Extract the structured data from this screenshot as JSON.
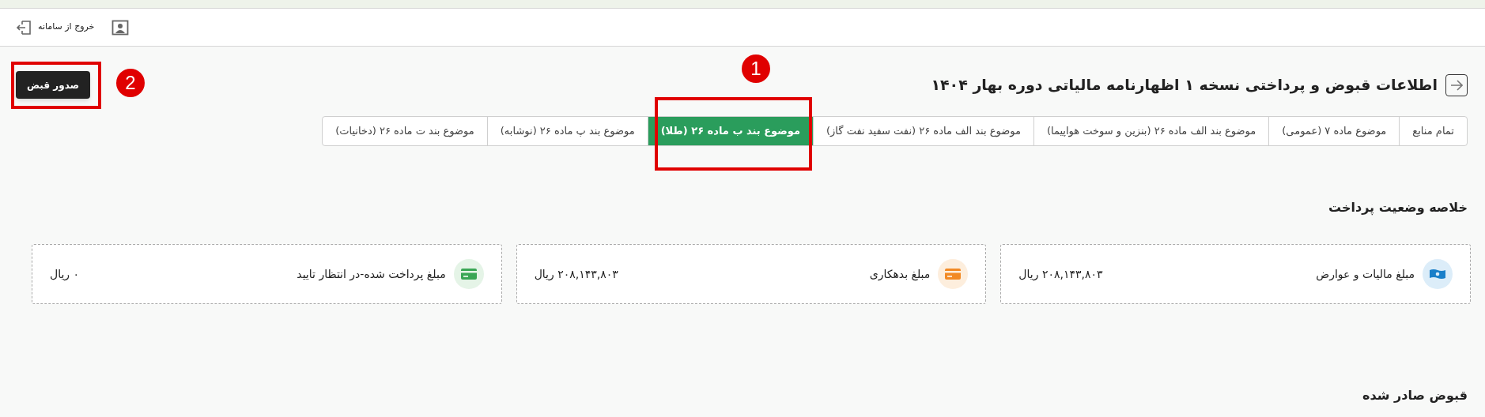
{
  "header": {
    "logout": "خروج از سامانه"
  },
  "page": {
    "title": "اطلاعات قبوض و پرداختی نسخه ۱ اظهارنامه مالیاتی دوره بهار ۱۴۰۴",
    "issue_button": "صدور قبض"
  },
  "tabs": [
    {
      "label": "تمام منابع",
      "selected": false
    },
    {
      "label": "موضوع ماده ۷ (عمومی)",
      "selected": false
    },
    {
      "label": "موضوع بند الف ماده ۲۶ (بنزین و سوخت هواپیما)",
      "selected": false
    },
    {
      "label": "موضوع بند الف ماده ۲۶ (نفت سفید نفت گاز)",
      "selected": false
    },
    {
      "label": "موضوع بند ب ماده ۲۶ (طلا)",
      "selected": true
    },
    {
      "label": "موضوع بند پ ماده ۲۶ (نوشابه)",
      "selected": false
    },
    {
      "label": "موضوع بند ت ماده ۲۶ (دخانیات)",
      "selected": false
    }
  ],
  "summary": {
    "heading": "خلاصه وضعیت پرداخت",
    "cards": [
      {
        "kind": "tax",
        "label": "مبلغ مالیات و عوارض",
        "amount": "۲۰۸,۱۴۳,۸۰۳ ریال"
      },
      {
        "kind": "debt",
        "label": "مبلغ بدهکاری",
        "amount": "۲۰۸,۱۴۳,۸۰۳ ریال"
      },
      {
        "kind": "pending",
        "label": "مبلغ پرداخت شده-در انتظار تایید",
        "amount": "۰ ریال"
      }
    ]
  },
  "receipts": {
    "heading": "قبوض صادر شده"
  },
  "annotations": [
    {
      "label": "1"
    },
    {
      "label": "2"
    }
  ]
}
